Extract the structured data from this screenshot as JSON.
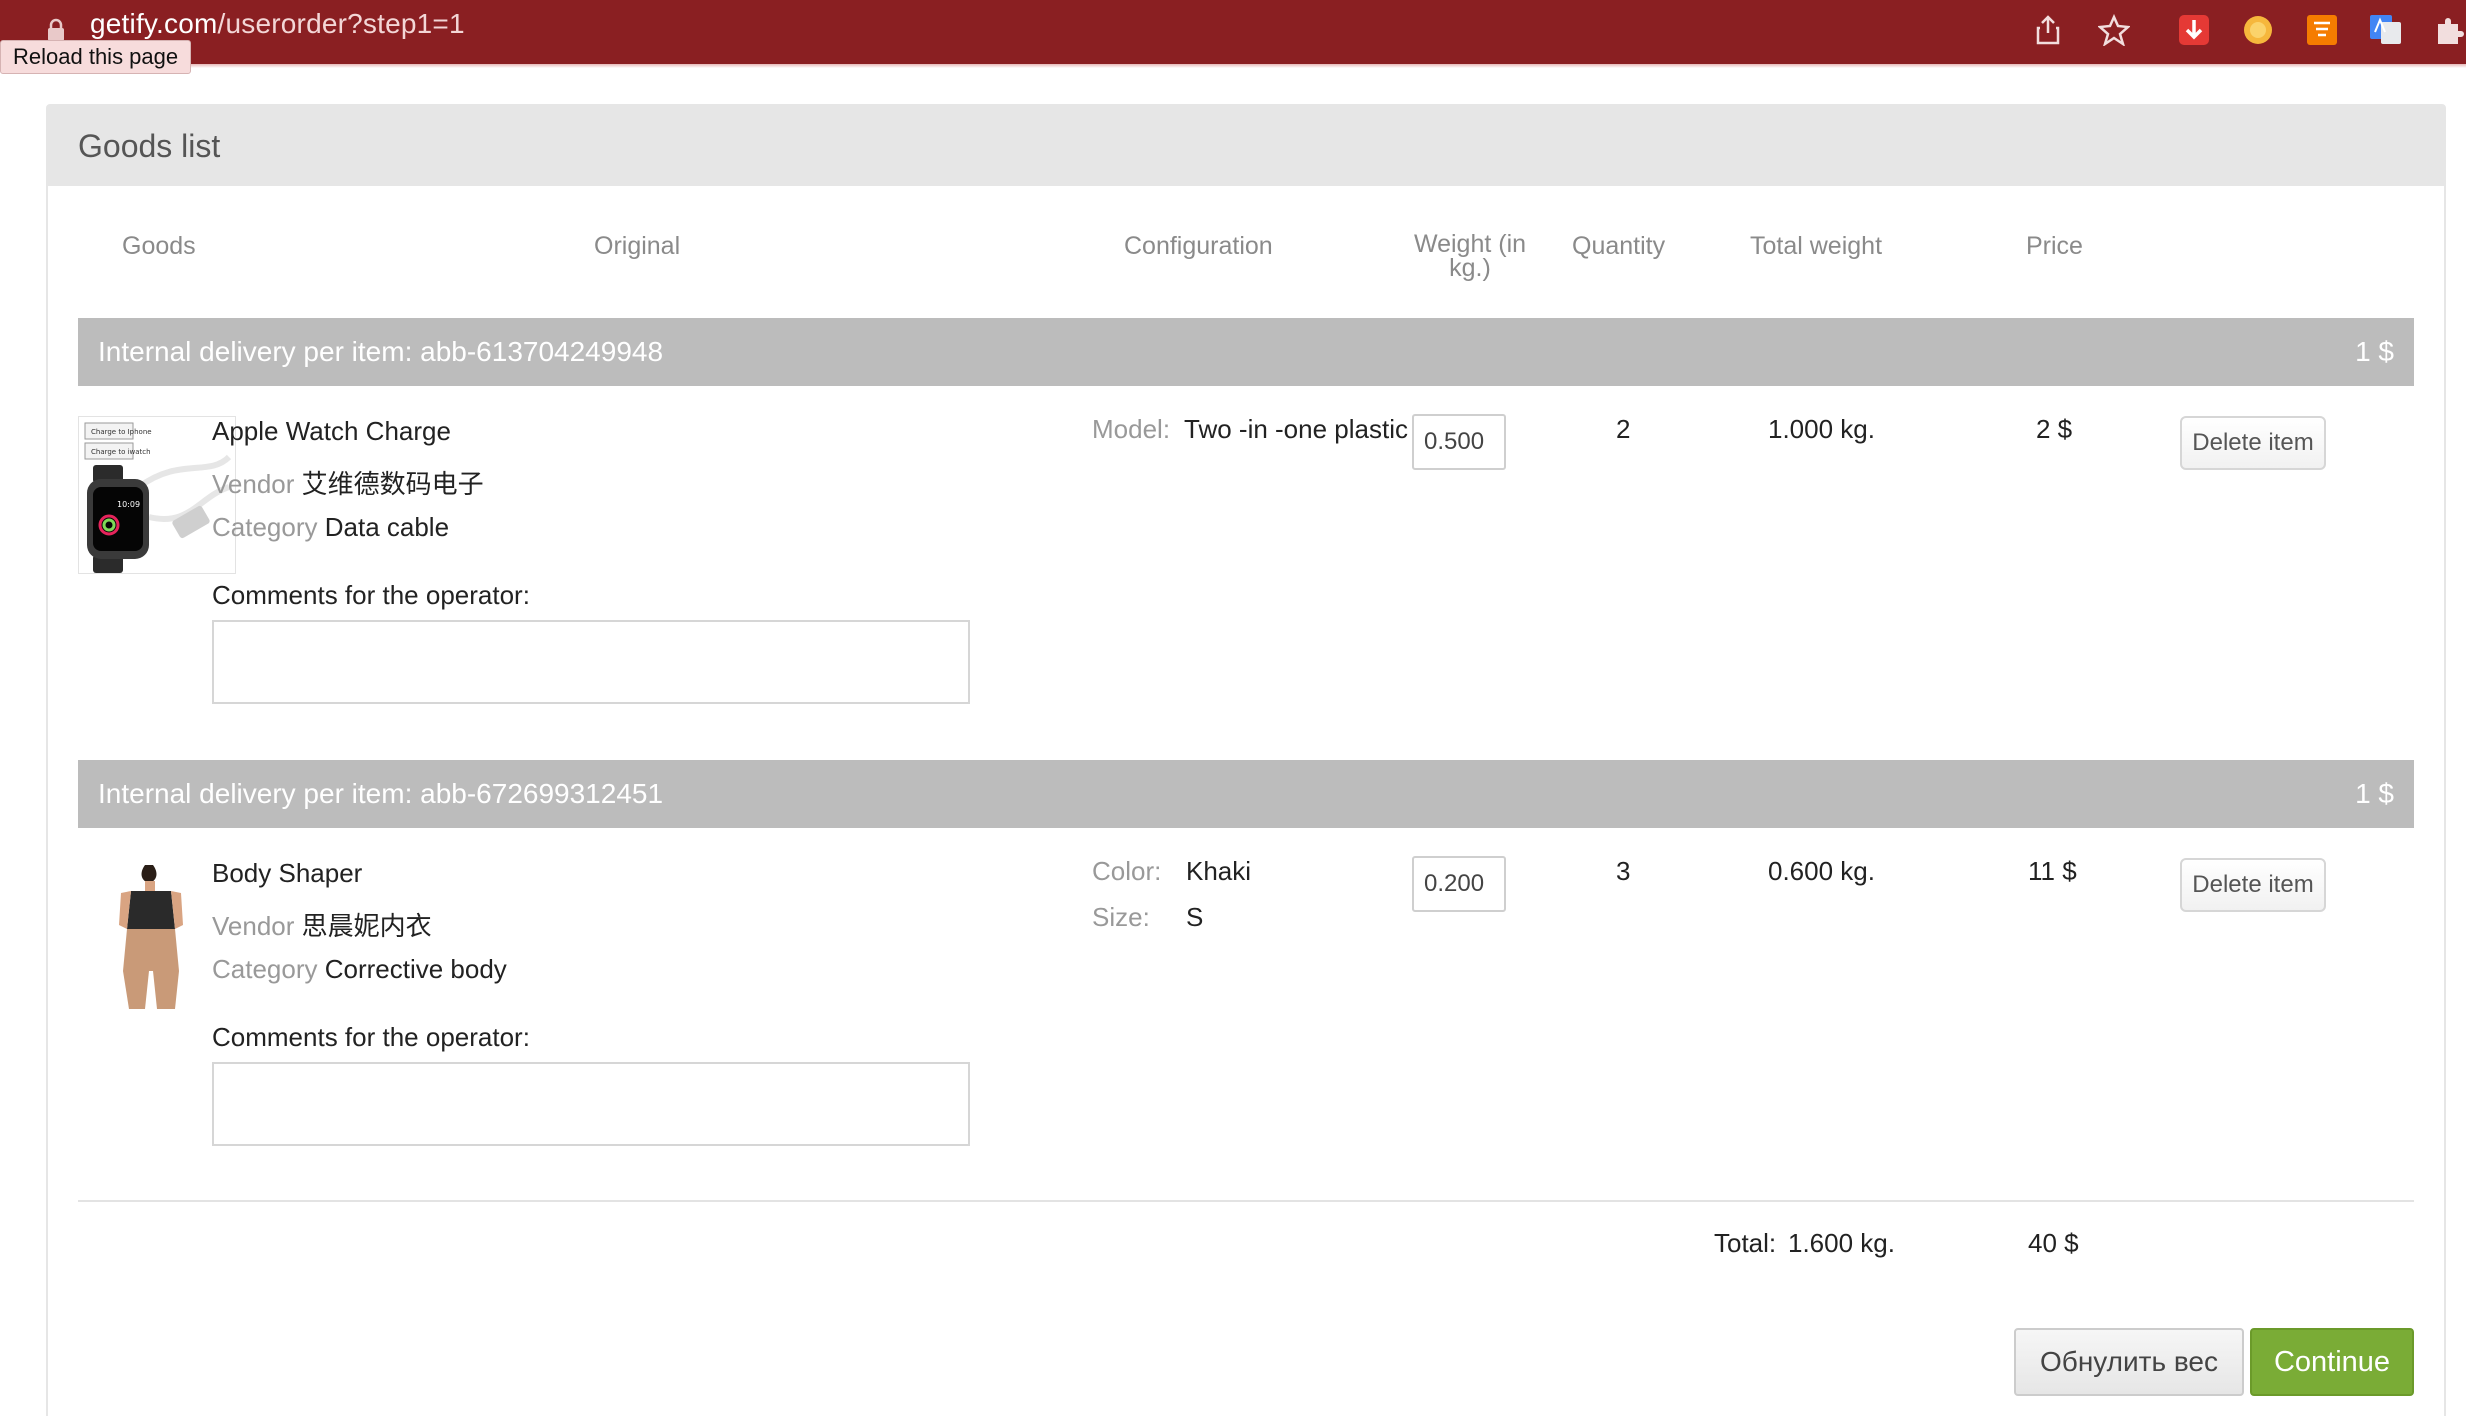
{
  "browser": {
    "url_host": "getify.com",
    "url_path": "/userorder?step1=1",
    "tooltip": "Reload this page",
    "colors": {
      "chrome": "#8a1f22"
    }
  },
  "page": {
    "title": "Goods list",
    "columns": {
      "goods": "Goods",
      "original": "Original",
      "configuration": "Configuration",
      "weight_line1": "Weight (in",
      "weight_line2": "kg.)",
      "quantity": "Quantity",
      "total_weight": "Total weight",
      "price": "Price"
    },
    "items": [
      {
        "delivery_label": "Internal delivery per item: abb-613704249948",
        "delivery_price": "1 $",
        "name": "Apple Watch Charge",
        "vendor_label": "Vendor",
        "vendor": "艾维德数码电子",
        "category_label": "Category",
        "category": "Data cable",
        "comments_label": "Comments for the operator:",
        "config": [
          {
            "label": "Model:",
            "value": "Two -in -one plastic"
          }
        ],
        "weight": "0.500",
        "quantity": "2",
        "total_weight": "1.000 kg.",
        "price": "2 $",
        "delete_label": "Delete item",
        "image_text": {
          "line1": "Charge to Iphone",
          "line2": "Charge to iwatch",
          "time": "10:09"
        }
      },
      {
        "delivery_label": "Internal delivery per item: abb-672699312451",
        "delivery_price": "1 $",
        "name": "Body Shaper",
        "vendor_label": "Vendor",
        "vendor": "思晨妮内衣",
        "category_label": "Category",
        "category": "Corrective body",
        "comments_label": "Comments for the operator:",
        "config": [
          {
            "label": "Color:",
            "value": "Khaki"
          },
          {
            "label": "Size:",
            "value": "S"
          }
        ],
        "weight": "0.200",
        "quantity": "3",
        "total_weight": "0.600 kg.",
        "price": "11 $",
        "delete_label": "Delete item"
      }
    ],
    "totals": {
      "label": "Total:",
      "weight": "1.600 kg.",
      "price": "40 $"
    },
    "buttons": {
      "reset_weight": "Обнулить вес",
      "continue": "Continue"
    },
    "colors": {
      "delivery_bar": "#bcbcbc",
      "continue_button": "#7aac36",
      "panel_header": "#e6e6e6"
    }
  }
}
